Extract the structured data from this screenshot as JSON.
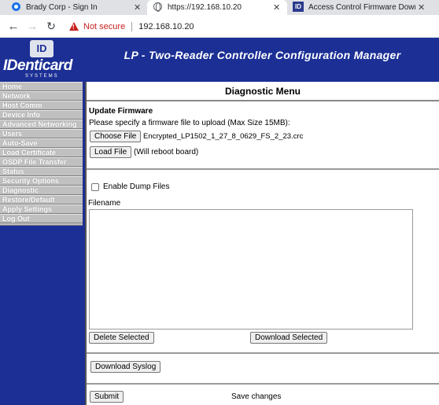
{
  "browser": {
    "tabs": [
      {
        "title": "Brady Corp - Sign In",
        "active": false,
        "icon": "circle-favicon-icon"
      },
      {
        "title": "https://192.168.10.20",
        "active": true,
        "icon": "globe-icon"
      },
      {
        "title": "Access Control Firmware Downlo",
        "active": false,
        "icon": "id-favicon-icon"
      }
    ],
    "close_glyph": "✕",
    "security_label": "Not secure",
    "url": "192.168.10.20",
    "nav_glyphs": {
      "back": "←",
      "forward": "→",
      "reload": "↻"
    }
  },
  "header": {
    "logo_badge": "ID",
    "logo_word": "IDenticard",
    "logo_sub": "SYSTEMS",
    "title": "LP - Two-Reader Controller Configuration Manager",
    "background": "#1b2f95"
  },
  "sidebar": {
    "items": [
      {
        "label": "Home"
      },
      {
        "label": "Network"
      },
      {
        "label": "Host Comm"
      },
      {
        "label": "Device Info"
      },
      {
        "label": "Advanced Networking"
      },
      {
        "label": "Users"
      },
      {
        "label": "Auto-Save"
      },
      {
        "label": "Load Certificate"
      },
      {
        "label": "OSDP File Transfer"
      },
      {
        "label": "Status"
      },
      {
        "label": "Security Options"
      },
      {
        "label": "Diagnostic"
      },
      {
        "label": "Restore/Default"
      },
      {
        "label": "Apply Settings"
      },
      {
        "label": "Log Out"
      }
    ]
  },
  "main": {
    "heading": "Diagnostic Menu",
    "firmware": {
      "title": "Update Firmware",
      "instructions": "Please specify a firmware file to upload (Max Size 15MB):",
      "choose_file_label": "Choose File",
      "selected_file": "Encrypted_LP1502_1_27_8_0629_FS_2_23.crc",
      "load_file_label": "Load File",
      "reboot_note": "(Will reboot board)"
    },
    "dump": {
      "enable_label": "Enable Dump Files",
      "checked": false,
      "filename_label": "Filename",
      "delete_label": "Delete Selected",
      "download_label": "Download Selected"
    },
    "syslog": {
      "download_label": "Download Syslog"
    },
    "footer": {
      "submit_label": "Submit",
      "caption": "Save changes"
    }
  }
}
